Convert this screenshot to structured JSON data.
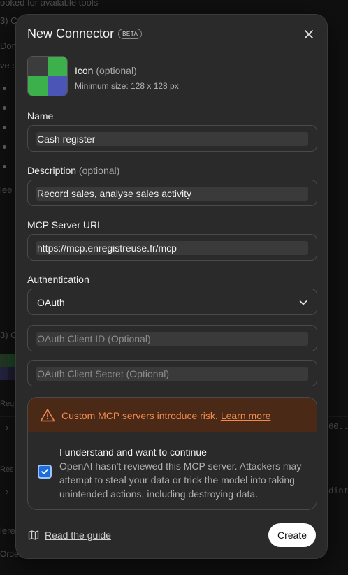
{
  "background": {
    "lines": [
      "ooked for available tools",
      "3) C",
      "Don",
      "ve c",
      "lee",
      "3) C",
      "Req",
      "Res",
      "60...",
      "dint",
      "lere",
      "Order"
    ]
  },
  "modal": {
    "title": "New Connector",
    "badge": "BETA",
    "icon_section": {
      "label": "Icon",
      "optional": "(optional)",
      "hint": "Minimum size: 128 x 128 px"
    },
    "name": {
      "label": "Name",
      "value": "Cash register"
    },
    "description": {
      "label": "Description",
      "optional": "(optional)",
      "value": "Record sales, analyse sales activity"
    },
    "mcp_url": {
      "label": "MCP Server URL",
      "value": "https://mcp.enregistreuse.fr/mcp"
    },
    "authentication": {
      "label": "Authentication",
      "selected": "OAuth"
    },
    "client_id": {
      "placeholder": "OAuth Client ID (Optional)"
    },
    "client_secret": {
      "placeholder": "OAuth Client Secret (Optional)"
    },
    "warning": {
      "message": "Custom MCP servers introduce risk.",
      "link": "Learn more",
      "ack_title": "I understand and want to continue",
      "ack_desc": "OpenAI hasn't reviewed this MCP server. Attackers may attempt to steal your data or trick the model into taking unintended actions, including destroying data.",
      "checked": true
    },
    "guide_link": "Read the guide",
    "create_button": "Create"
  },
  "colors": {
    "accent_checkbox": "#1d6ed8",
    "warning_text": "#f08a50",
    "warning_bg": "#4a2a17"
  }
}
